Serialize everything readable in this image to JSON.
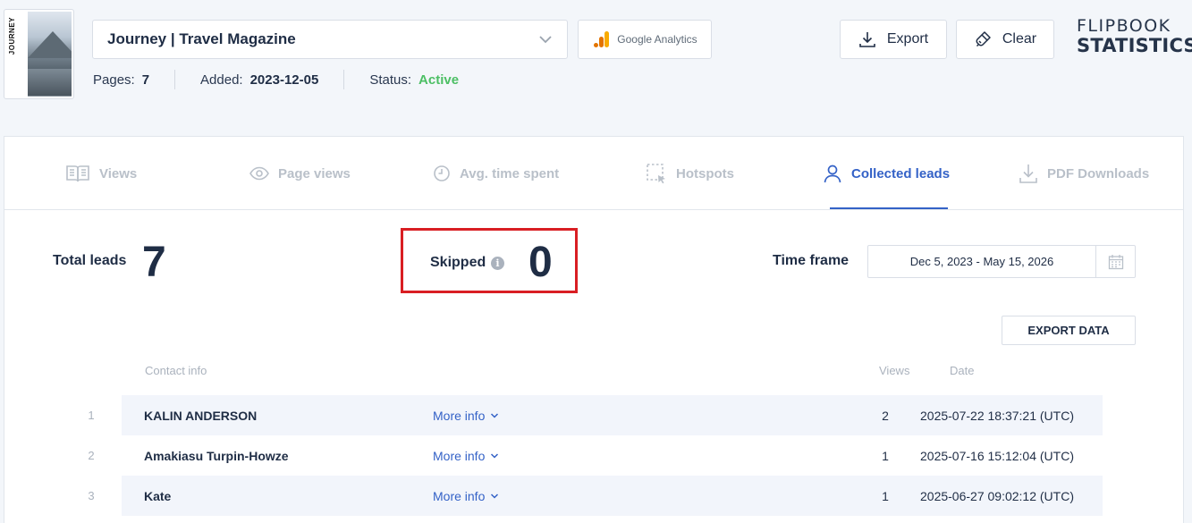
{
  "publication": {
    "cover_spine_text": "JOURNEY",
    "selected": "Journey | Travel Magazine",
    "google_analytics_label": "Google Analytics",
    "meta": {
      "pages_label": "Pages:",
      "pages_value": "7",
      "added_label": "Added:",
      "added_value": "2023-12-05",
      "status_label": "Status:",
      "status_value": "Active"
    }
  },
  "header": {
    "export_label": "Export",
    "clear_label": "Clear",
    "brand_line1": "FLIPBOOK",
    "brand_line2": "STATISTICS"
  },
  "tabs": [
    {
      "label": "Views",
      "icon": "book-icon",
      "active": false
    },
    {
      "label": "Page views",
      "icon": "eye-icon",
      "active": false
    },
    {
      "label": "Avg. time spent",
      "icon": "clock-icon",
      "active": false
    },
    {
      "label": "Hotspots",
      "icon": "hotspot-icon",
      "active": false
    },
    {
      "label": "Collected leads",
      "icon": "user-icon",
      "active": true
    },
    {
      "label": "PDF Downloads",
      "icon": "download-icon",
      "active": false
    }
  ],
  "summary": {
    "total_label": "Total leads",
    "total_value": "7",
    "skipped_label": "Skipped",
    "skipped_value": "0",
    "timeframe_label": "Time frame",
    "timeframe_value": "Dec 5, 2023 - May 15, 2026"
  },
  "export_data_label": "EXPORT DATA",
  "table": {
    "headers": {
      "contact": "Contact info",
      "views": "Views",
      "date": "Date"
    },
    "more_info_label": "More info",
    "rows": [
      {
        "num": "1",
        "name": "KALIN ANDERSON",
        "views": "2",
        "date": "2025-07-22 18:37:21 (UTC)"
      },
      {
        "num": "2",
        "name": "Amakiasu Turpin-Howze",
        "views": "1",
        "date": "2025-07-16 15:12:04 (UTC)"
      },
      {
        "num": "3",
        "name": "Kate",
        "views": "1",
        "date": "2025-06-27 09:02:12 (UTC)"
      }
    ]
  },
  "colors": {
    "accent": "#3462c7",
    "active_status": "#4cbf64",
    "highlight_border": "#d91e23",
    "text_dark": "#1f2d45",
    "muted": "#b9c0c9"
  }
}
